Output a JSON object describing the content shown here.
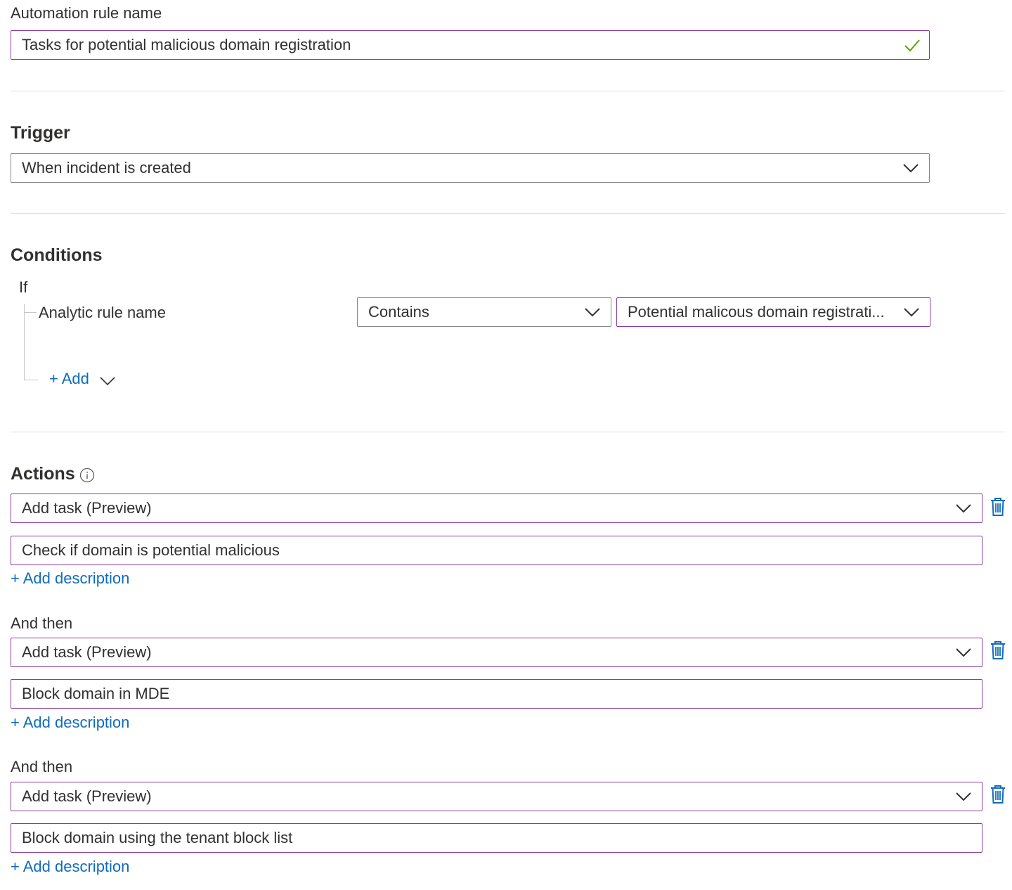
{
  "rule_name": {
    "label": "Automation rule name",
    "value": "Tasks for potential malicious domain registration"
  },
  "trigger": {
    "title": "Trigger",
    "selected": "When incident is created"
  },
  "conditions": {
    "title": "Conditions",
    "if_label": "If",
    "property": "Analytic rule name",
    "operator": "Contains",
    "value": "Potential malicous domain registrati...",
    "add_label": "+ Add"
  },
  "actions": {
    "title": "Actions",
    "info_icon": "info-icon",
    "and_then_label": "And then",
    "items": [
      {
        "type": "Add task (Preview)",
        "task_title": "Check if domain is potential malicious",
        "add_description": "+ Add description"
      },
      {
        "type": "Add task (Preview)",
        "task_title": "Block domain in MDE",
        "add_description": "+ Add description"
      },
      {
        "type": "Add task (Preview)",
        "task_title": "Block domain using the tenant block list",
        "add_description": "+ Add description"
      }
    ]
  },
  "colors": {
    "accent_border": "#8a3a9e",
    "link": "#0f6cbd",
    "success_check": "#57a300"
  }
}
